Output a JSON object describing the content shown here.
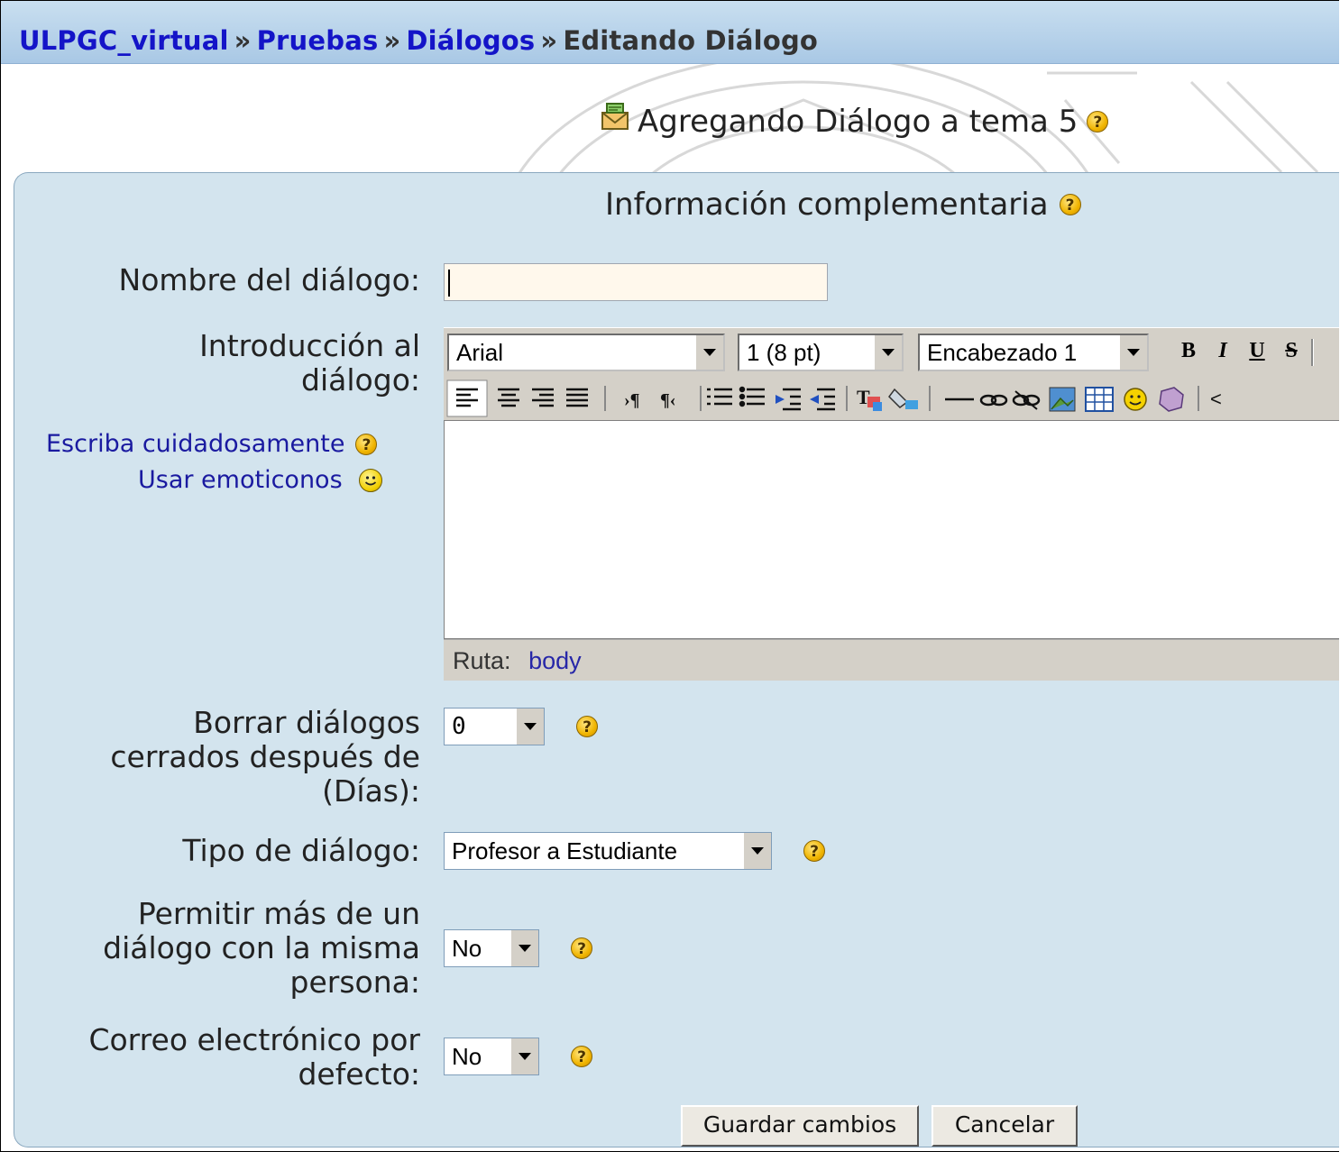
{
  "breadcrumb": {
    "site": "ULPGC_virtual",
    "course": "Pruebas",
    "module": "Diálogos",
    "current": "Editando Diálogo",
    "separator": "»"
  },
  "page_heading": "Agregando Diálogo a tema 5",
  "section_title": "Información complementaria",
  "form": {
    "name_label": "Nombre del diálogo:",
    "name_value": "",
    "intro_label": "Introducción al diálogo:",
    "intro_value": "",
    "help_links": {
      "write_carefully": "Escriba cuidadosamente",
      "use_emoticons": "Usar emoticonos"
    },
    "delete_label": "Borrar diálogos cerrados después de (Días):",
    "delete_value": "0",
    "type_label": "Tipo de diálogo:",
    "type_value": "Profesor a Estudiante",
    "multiple_label": "Permitir más de un diálogo con la misma persona:",
    "multiple_value": "No",
    "email_label": "Correo electrónico por defecto:",
    "email_value": "No"
  },
  "editor": {
    "font": "Arial",
    "size": "1 (8 pt)",
    "format": "Encabezado 1",
    "bold": "B",
    "italic": "I",
    "underline": "U",
    "strike": "S",
    "status_label": "Ruta:",
    "status_path": "body"
  },
  "buttons": {
    "save": "Guardar cambios",
    "cancel": "Cancelar"
  }
}
